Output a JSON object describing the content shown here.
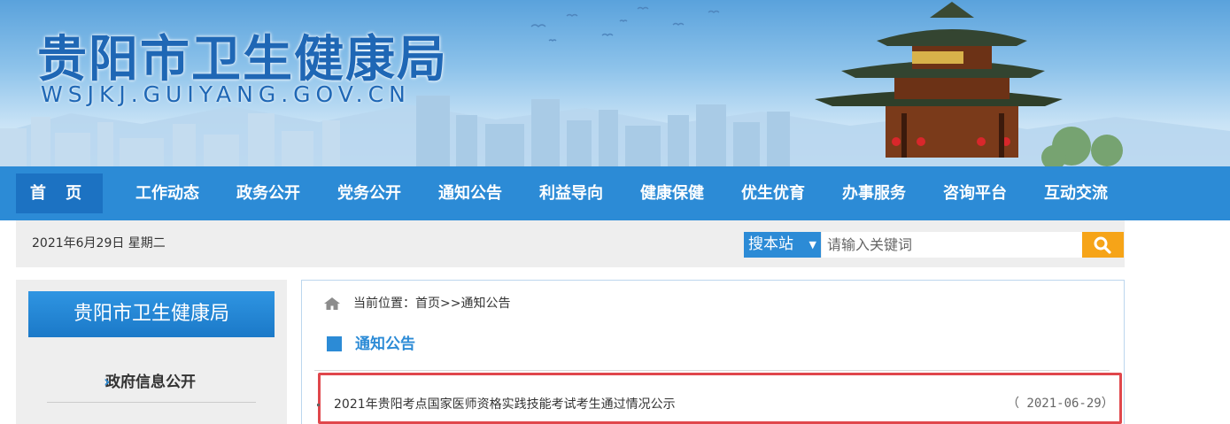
{
  "header": {
    "title": "贵阳市卫生健康局",
    "domain": "WSJKJ.GUIYANG.GOV.CN"
  },
  "nav": {
    "items": [
      "首 页",
      "工作动态",
      "政务公开",
      "党务公开",
      "通知公告",
      "利益导向",
      "健康保健",
      "优生优育",
      "办事服务",
      "咨询平台",
      "互动交流"
    ],
    "active_index": 0
  },
  "infobar": {
    "date": "2021年6月29日  星期二",
    "search_scope": "搜本站",
    "search_placeholder": "请输入关键词"
  },
  "sidebar": {
    "title": "贵阳市卫生健康局",
    "items": [
      "政府信息公开"
    ]
  },
  "main": {
    "breadcrumb": "当前位置：首页>>通知公告",
    "section_title": "通知公告",
    "notices": [
      {
        "title": "2021年贵阳考点国家医师资格实践技能考试考生通过情况公示",
        "date": "（ 2021-06-29）"
      }
    ]
  },
  "colors": {
    "nav_bg": "#2c8bd6",
    "nav_active": "#1c72c2",
    "search_button": "#f6a418",
    "highlight_border": "#e0474c",
    "title_blue": "#1f67b5"
  }
}
